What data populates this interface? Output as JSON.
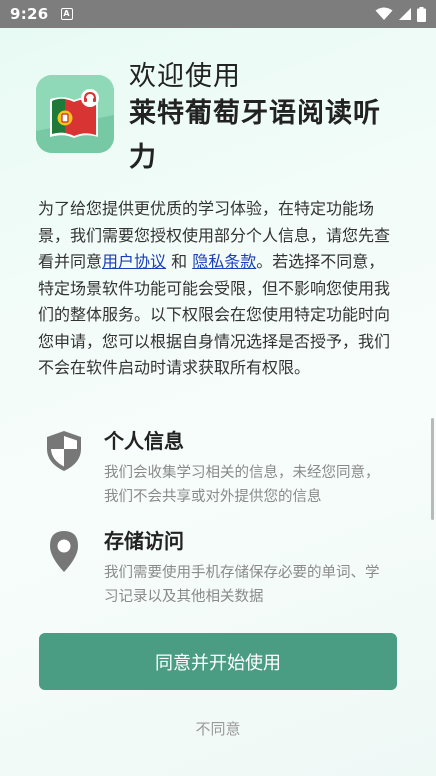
{
  "status_bar": {
    "time": "9:26",
    "notification_letter": "A",
    "icons": [
      "wifi-icon",
      "signal-icon",
      "battery-icon"
    ]
  },
  "header": {
    "welcome": "欢迎使用",
    "app_name": "莱特葡萄牙语阅读听力"
  },
  "intro": {
    "part1": "为了给您提供更优质的学习体验，在特定功能场景，我们需要您授权使用部分个人信息，请您先查看并同意",
    "user_agreement": "用户协议",
    "and": " 和 ",
    "privacy_policy": "隐私条款",
    "part2": "。若选择不同意，特定场景软件功能可能会受限，但不影响您使用我们的整体服务。以下权限会在您使用特定功能时向您申请，您可以根据自身情况选择是否授予，我们不会在软件启动时请求获取所有权限。"
  },
  "permissions": [
    {
      "icon": "shield-icon",
      "title": "个人信息",
      "description": "我们会收集学习相关的信息，未经您同意，我们不会共享或对外提供您的信息"
    },
    {
      "icon": "location-pin-icon",
      "title": "存储访问",
      "description": "我们需要使用手机存储保存必要的单词、学习记录以及其他相关数据"
    }
  ],
  "actions": {
    "agree_label": "同意并开始使用",
    "disagree_label": "不同意"
  },
  "colors": {
    "accent": "#4a9d82",
    "link": "#1a3fb8",
    "status_bar": "#7d7d7d"
  }
}
